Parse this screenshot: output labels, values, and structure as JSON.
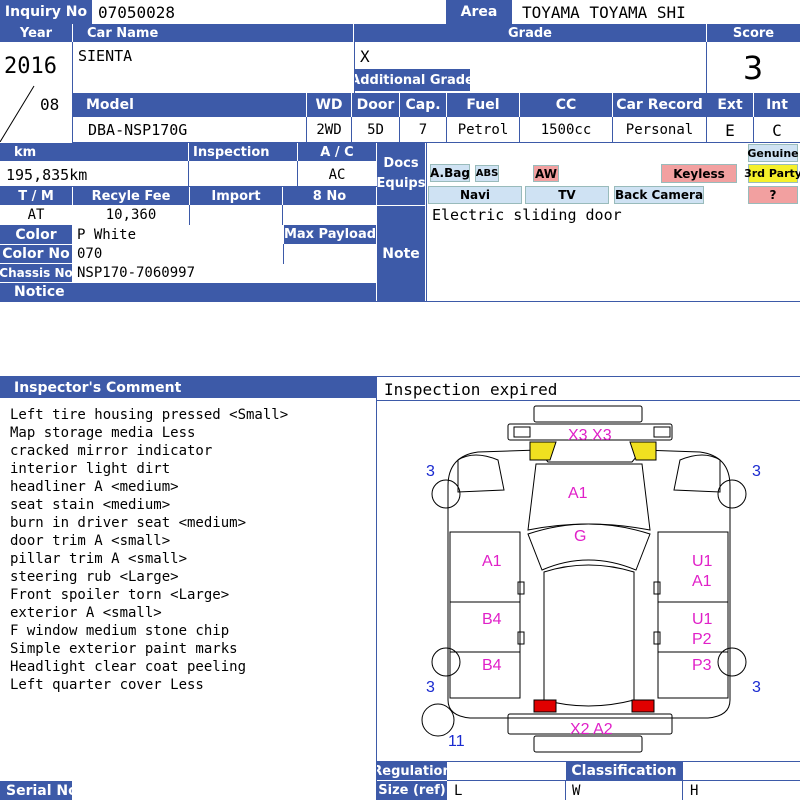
{
  "labels": {
    "inquiry_no": "Inquiry No",
    "area": "Area",
    "year": "Year",
    "car_name": "Car Name",
    "grade": "Grade",
    "score": "Score",
    "additional_grade": "Additional Grade",
    "model": "Model",
    "wd": "WD",
    "door": "Door",
    "cap": "Cap.",
    "fuel": "Fuel",
    "cc": "CC",
    "car_record": "Car Record",
    "ext": "Ext",
    "int": "Int",
    "km": "km",
    "inspection": "Inspection",
    "ac": "A / C",
    "docs_equips_1": "Docs",
    "docs_equips_2": "Equips",
    "tm": "T / M",
    "recycle_fee": "Recyle Fee",
    "import": "Import",
    "eight_no": "8 No",
    "color": "Color",
    "max_payload": "Max Payload",
    "color_no": "Color No",
    "chassis_no": "Chassis No",
    "notice": "Notice",
    "note": "Note",
    "inspector_comment": "Inspector's Comment",
    "regulation": "Regulation",
    "classification": "Classification",
    "size_ref": "Size (ref)",
    "serial_no": "Serial No",
    "size_l": "L",
    "size_w": "W",
    "size_h": "H"
  },
  "values": {
    "inquiry_no": "07050028",
    "area": "TOYAMA TOYAMA SHI",
    "year": "2016",
    "month": "08",
    "car_name": "SIENTA",
    "grade": "X",
    "score": "3",
    "model": "DBA-NSP170G",
    "wd": "2WD",
    "door": "5D",
    "cap": "7",
    "fuel": "Petrol",
    "cc": "1500cc",
    "car_record": "Personal",
    "ext": "E",
    "int": "C",
    "km": "195,835km",
    "ac": "AC",
    "tm": "AT",
    "recycle_fee": "10,360",
    "color": "P White",
    "color_no": "070",
    "chassis_no": "NSP170-7060997",
    "note": "Electric sliding door",
    "inspection_status": "Inspection expired"
  },
  "equipment": {
    "abag": "A.Bag",
    "abs": "ABS",
    "aw": "AW",
    "keyless": "Keyless",
    "genuine": "Genuine",
    "third_party": "3rd Party",
    "navi": "Navi",
    "tv": "TV",
    "back_camera": "Back Camera",
    "unknown": "?"
  },
  "comments": [
    "Left tire housing pressed <Small>",
    "Map storage media Less",
    "cracked mirror indicator",
    "interior light dirt",
    "headliner A <medium>",
    "seat stain <medium>",
    "burn in driver seat <medium>",
    "door trim A <small>",
    "pillar trim A <small>",
    "steering rub <Large>",
    "Front spoiler torn <Large>",
    "exterior A <small>",
    "F window medium stone chip",
    "Simple exterior paint marks",
    "Headlight clear coat peeling",
    "Left quarter cover Less"
  ],
  "diagram": {
    "front": "X3  X3",
    "hood": "A1",
    "windshield": "G",
    "left_front_door": "A1",
    "left_rear_door": "B4",
    "left_quarter": "B4",
    "right_front_door_1": "U1",
    "right_front_door_2": "A1",
    "right_rear_door_1": "U1",
    "right_rear_door_2": "P2",
    "right_quarter": "P3",
    "rear": "X2  A2",
    "tire_fl": "3",
    "tire_fr": "3",
    "tire_rl": "3",
    "tire_rr": "3",
    "spare": "11"
  },
  "colors": {
    "header": "#3d5aa8",
    "mark": "#e020c8",
    "tire": "#1a2ad0",
    "light_yellow": "#f0e020",
    "light_red": "#e00000"
  }
}
